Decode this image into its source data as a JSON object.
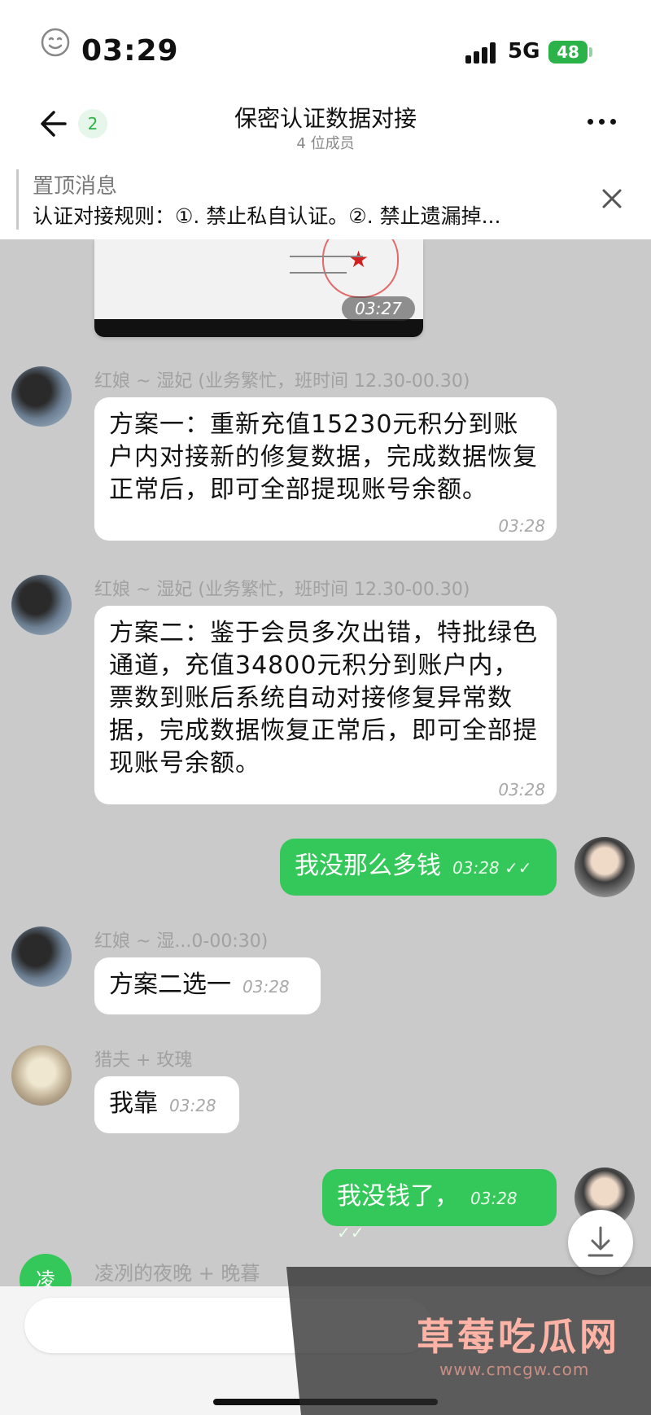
{
  "status": {
    "time": "03:29",
    "network": "5G",
    "battery": "48"
  },
  "header": {
    "unread": "2",
    "title": "保密认证数据对接",
    "subtitle": "4 位成员"
  },
  "pinned": {
    "title": "置顶消息",
    "text": "认证对接规则：①. 禁止私自认证。②. 禁止遗漏掉..."
  },
  "image_card": {
    "time": "03:27"
  },
  "messages": [
    {
      "sender": "红娘 ~ 湿妃 (业务繁忙，班时间 12.30-00.30)",
      "text": "方案一：重新充值15230元积分到账户内对接新的修复数据，完成数据恢复正常后，即可全部提现账号余额。",
      "time": "03:28"
    },
    {
      "sender": "红娘 ~ 湿妃 (业务繁忙，班时间 12.30-00.30)",
      "text": "方案二：鉴于会员多次出错，特批绿色通道，充值34800元积分到账户内，票数到账后系统自动对接修复异常数据，完成数据恢复正常后，即可全部提现账号余额。",
      "time": "03:28"
    },
    {
      "text": "我没那么多钱",
      "time": "03:28 ✓✓"
    },
    {
      "sender": "红娘 ~ 湿...0-00:30)",
      "text": "方案二选一",
      "time": "03:28"
    },
    {
      "sender": "猎夫 + 玫瑰",
      "text": "我靠",
      "time": "03:28"
    },
    {
      "text": "我没钱了，",
      "time": "03:28 ✓✓"
    }
  ],
  "bottom_member": {
    "initial": "凌",
    "name": "凌冽的夜晚 + 晚暮"
  },
  "watermark": {
    "title": "草莓吃瓜网",
    "url": "www.cmcgw.com"
  }
}
